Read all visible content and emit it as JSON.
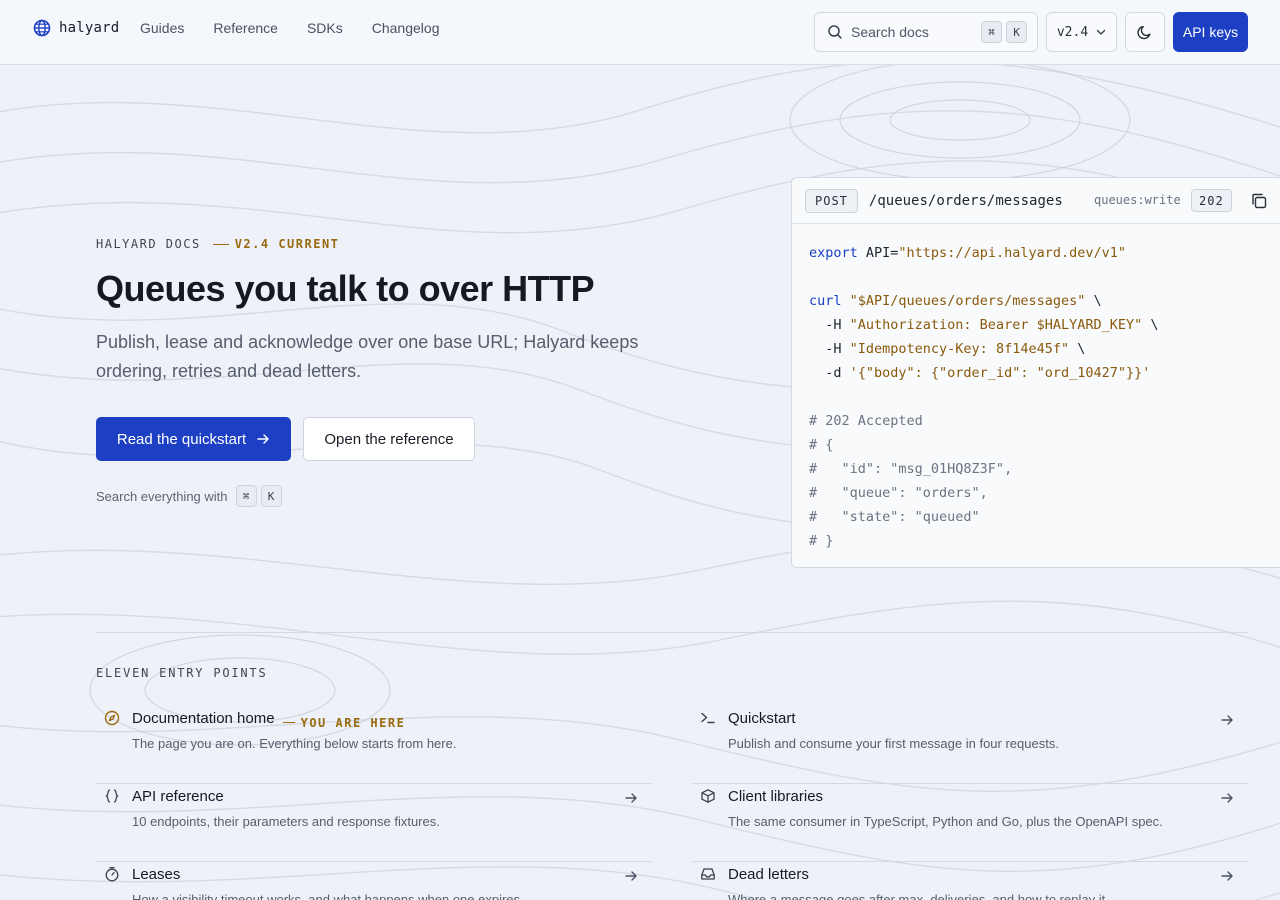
{
  "brand": {
    "name": "halyard",
    "icon": "globe-icon",
    "accent": "#1c3fc4"
  },
  "nav": [
    {
      "label": "Guides"
    },
    {
      "label": "Reference"
    },
    {
      "label": "SDKs"
    },
    {
      "label": "Changelog"
    }
  ],
  "search": {
    "placeholder": "Search docs",
    "shortcut_mod": "⌘",
    "shortcut_key": "K"
  },
  "version": {
    "selected": "v2.4"
  },
  "header": {
    "theme_icon": "moon-icon",
    "api_keys_label": "API keys"
  },
  "hero": {
    "eyebrow": "HALYARD DOCS",
    "eyebrow_version": "V2.4 CURRENT",
    "title": "Queues you talk to over HTTP",
    "subtitle": "Publish, lease and acknowledge over one base URL; Halyard keeps ordering, retries and dead letters.",
    "primary_cta": "Read the quickstart",
    "secondary_cta": "Open the reference",
    "hint": "Search everything with",
    "hint_mod": "⌘",
    "hint_key": "K"
  },
  "code_card": {
    "method": "POST",
    "path": "/queues/orders/messages",
    "scope": "queues:write",
    "status": "202",
    "lines": [
      [
        {
          "t": "kw",
          "v": "export"
        },
        {
          "t": "txt",
          "v": " API="
        },
        {
          "t": "str",
          "v": "\"https://api.halyard.dev/v1\""
        }
      ],
      [],
      [
        {
          "t": "kw",
          "v": "curl"
        },
        {
          "t": "txt",
          "v": " "
        },
        {
          "t": "str",
          "v": "\"$API/queues/orders/messages\""
        },
        {
          "t": "txt",
          "v": " \\"
        }
      ],
      [
        {
          "t": "txt",
          "v": "  -H "
        },
        {
          "t": "str",
          "v": "\"Authorization: Bearer $HALYARD_KEY\""
        },
        {
          "t": "txt",
          "v": " \\"
        }
      ],
      [
        {
          "t": "txt",
          "v": "  -H "
        },
        {
          "t": "str",
          "v": "\"Idempotency-Key: 8f14e45f\""
        },
        {
          "t": "txt",
          "v": " \\"
        }
      ],
      [
        {
          "t": "txt",
          "v": "  -d "
        },
        {
          "t": "str",
          "v": "'{\"body\": {\"order_id\": \"ord_10427\"}}'"
        }
      ],
      [],
      [
        {
          "t": "cmt",
          "v": "# 202 Accepted"
        }
      ],
      [
        {
          "t": "cmt",
          "v": "# {"
        }
      ],
      [
        {
          "t": "cmt",
          "v": "#   \"id\": \"msg_01HQ8Z3F\","
        }
      ],
      [
        {
          "t": "cmt",
          "v": "#   \"queue\": \"orders\","
        }
      ],
      [
        {
          "t": "cmt",
          "v": "#   \"state\": \"queued\""
        }
      ],
      [
        {
          "t": "cmt",
          "v": "# }"
        }
      ]
    ]
  },
  "entry_points": {
    "label": "ELEVEN ENTRY POINTS",
    "items": [
      {
        "icon": "compass-icon",
        "title": "Documentation home",
        "tag": "YOU ARE HERE",
        "desc": "The page you are on. Everything below starts from here."
      },
      {
        "icon": "terminal-icon",
        "title": "Quickstart",
        "desc": "Publish and consume your first message in four requests."
      },
      {
        "icon": "braces-icon",
        "title": "API reference",
        "desc": "10 endpoints, their parameters and response fixtures."
      },
      {
        "icon": "package-icon",
        "title": "Client libraries",
        "desc": "The same consumer in TypeScript, Python and Go, plus the OpenAPI spec."
      },
      {
        "icon": "timer-icon",
        "title": "Leases",
        "desc": "How a visibility timeout works, and what happens when one expires."
      },
      {
        "icon": "inbox-icon",
        "title": "Dead letters",
        "desc": "Where a message goes after max_deliveries, and how to replay it."
      }
    ]
  }
}
